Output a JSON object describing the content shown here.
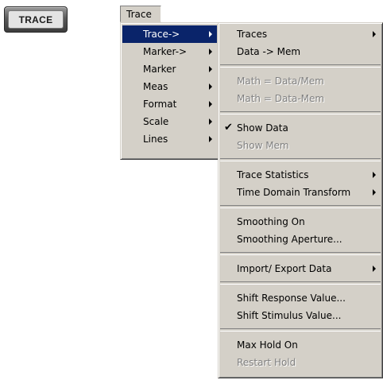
{
  "hardware_key": {
    "label": "TRACE"
  },
  "menubar": {
    "trace_label": "Trace"
  },
  "trace_menu": {
    "items": [
      {
        "label": "Trace->"
      },
      {
        "label": "Marker->"
      },
      {
        "label": "Marker"
      },
      {
        "label": "Meas"
      },
      {
        "label": "Format"
      },
      {
        "label": "Scale"
      },
      {
        "label": "Lines"
      }
    ]
  },
  "trace_submenu": {
    "check_mark": "✔",
    "items": [
      {
        "label": "Traces"
      },
      {
        "label": "Data -> Mem"
      },
      {
        "label": "Math = Data/Mem"
      },
      {
        "label": "Math = Data-Mem"
      },
      {
        "label": "Show Data"
      },
      {
        "label": "Show Mem"
      },
      {
        "label": "Trace Statistics"
      },
      {
        "label": "Time Domain Transform"
      },
      {
        "label": "Smoothing On"
      },
      {
        "label": "Smoothing Aperture..."
      },
      {
        "label": "Import/ Export Data"
      },
      {
        "label": "Shift Response Value..."
      },
      {
        "label": "Shift Stimulus Value..."
      },
      {
        "label": "Max Hold On"
      },
      {
        "label": "Restart Hold"
      }
    ]
  },
  "colors": {
    "menu_background": "#d4d0c8",
    "highlight": "#0a246a",
    "disabled_text": "#808080"
  }
}
